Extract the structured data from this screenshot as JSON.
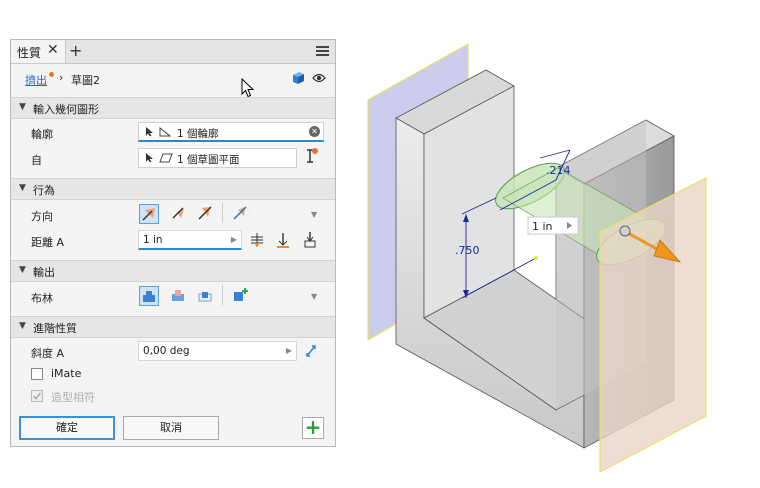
{
  "panel": {
    "tab_label": "性質",
    "tab_close": "✕",
    "tab_add": "+",
    "breadcrumb": {
      "link": "擠出",
      "separator": "›",
      "current": "草圖2"
    }
  },
  "sections": {
    "input": "輸入幾何圖形",
    "behavior": "行為",
    "output": "輸出",
    "advanced": "進階性質"
  },
  "input": {
    "profile_label": "輪廓",
    "profile_value": "1 個輪廓",
    "from_label": "自",
    "from_value": "1 個草圖平面"
  },
  "behavior": {
    "direction_label": "方向",
    "distance_label": "距離 A",
    "distance_value": "1 in"
  },
  "output": {
    "boolean_label": "布林"
  },
  "advanced": {
    "taper_label": "斜度 A",
    "taper_value": "0,00 deg",
    "imate_label": "iMate",
    "match_shape_label": "造型相符"
  },
  "buttons": {
    "ok": "確定",
    "cancel": "取消",
    "add": "+"
  },
  "viewport": {
    "dim_width": ".214",
    "dim_height": ".750",
    "distance_input": "1 in",
    "colors": {
      "left_plane": "#c3c3ea",
      "right_plane": "#e9d6c6",
      "preview": "#c8e4b8",
      "arrow": "#f0961e",
      "dimension": "#1a2a9a"
    }
  }
}
